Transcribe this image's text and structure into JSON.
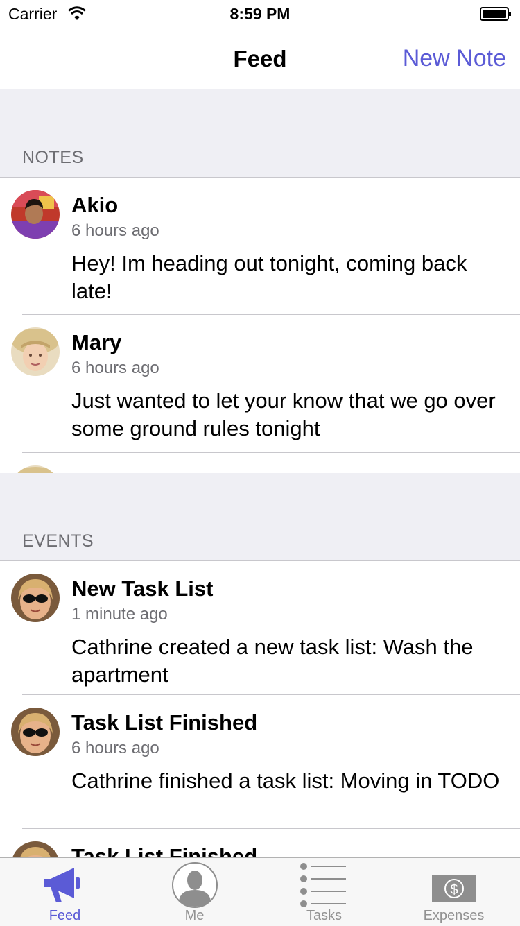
{
  "status_bar": {
    "carrier": "Carrier",
    "time": "8:59 PM"
  },
  "nav": {
    "title": "Feed",
    "action": "New Note"
  },
  "sections": {
    "notes": {
      "header": "NOTES",
      "items": [
        {
          "name": "Akio",
          "time": "6 hours ago",
          "body": "Hey! Im heading out tonight, coming back late!"
        },
        {
          "name": "Mary",
          "time": "6 hours ago",
          "body": "Just wanted to let your know that we go over some ground rules tonight"
        }
      ]
    },
    "events": {
      "header": "EVENTS",
      "items": [
        {
          "name": "New Task List",
          "time": "1 minute ago",
          "body": "Cathrine created a new task list: Wash the apartment"
        },
        {
          "name": "Task List Finished",
          "time": "6 hours ago",
          "body": "Cathrine finished a task list: Moving in TODO"
        },
        {
          "name": "Task List Finished"
        }
      ]
    }
  },
  "tabs": [
    {
      "label": "Feed",
      "icon": "megaphone-icon",
      "active": true
    },
    {
      "label": "Me",
      "icon": "person-icon",
      "active": false
    },
    {
      "label": "Tasks",
      "icon": "list-icon",
      "active": false
    },
    {
      "label": "Expenses",
      "icon": "money-icon",
      "active": false
    }
  ],
  "colors": {
    "accent": "#5b5bd6",
    "section_bg": "#efeff4",
    "separator": "#c8c7cc"
  }
}
